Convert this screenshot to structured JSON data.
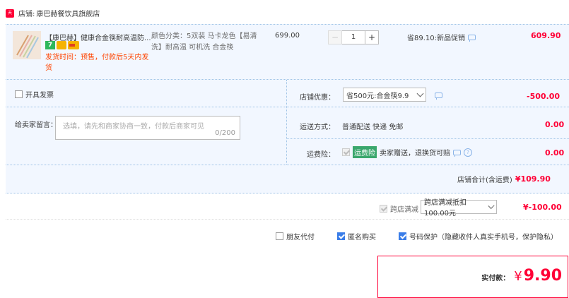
{
  "store": {
    "label": "店铺:",
    "name": "康巴赫餐饮具旗舰店",
    "badge": "天猫"
  },
  "item": {
    "title": "【康巴赫】健康合金筷耐高温防...",
    "ship_time": "发货时间：预售，付款后5天内发货",
    "sku_label": "颜色分类：",
    "sku_value": "5双装 马卡龙色【易清洗】耐高温 可机洗 合金筷",
    "unit_price": "699.00",
    "quantity": "1",
    "promo": "省89.10:新品促销",
    "subtotal": "609.90",
    "colors": {
      "thumb_bg": "#f3e6da",
      "tag_green": "#2db75b",
      "tag_yellow": "#f5b300"
    }
  },
  "invoice": {
    "label": "开具发票"
  },
  "store_coupon": {
    "label": "店铺优惠：",
    "selected": "省500元:合金筷9.9",
    "amount": "-500.00"
  },
  "note": {
    "label": "给卖家留言：",
    "placeholder": "选填，请先和商家协商一致，付款后商家可见",
    "counter": "0/200"
  },
  "shipping": {
    "label": "运送方式：",
    "value": "普通配送 快递 免邮",
    "amount": "0.00"
  },
  "insurance": {
    "label": "运费险：",
    "tag": "运费险",
    "text": "卖家赠送，退换货可赔",
    "amount": "0.00"
  },
  "store_total": {
    "label": "店铺合计(含运费)",
    "amount": "¥109.90"
  },
  "cross_store": {
    "label": "跨店满减",
    "selected": "跨店满减抵扣100.00元",
    "amount": "¥-100.00"
  },
  "options": [
    {
      "label": "朋友代付",
      "checked": false
    },
    {
      "label": "匿名购买",
      "checked": true
    },
    {
      "label": "号码保护（隐藏收件人真实手机号，保护隐私）",
      "checked": true
    }
  ],
  "pay": {
    "label": "实付款：",
    "currency": "¥",
    "amount": "9.90"
  },
  "colors": {
    "accent_red": "#ff0036",
    "orange": "#ff4400",
    "section_bg": "#f2f7ff"
  }
}
